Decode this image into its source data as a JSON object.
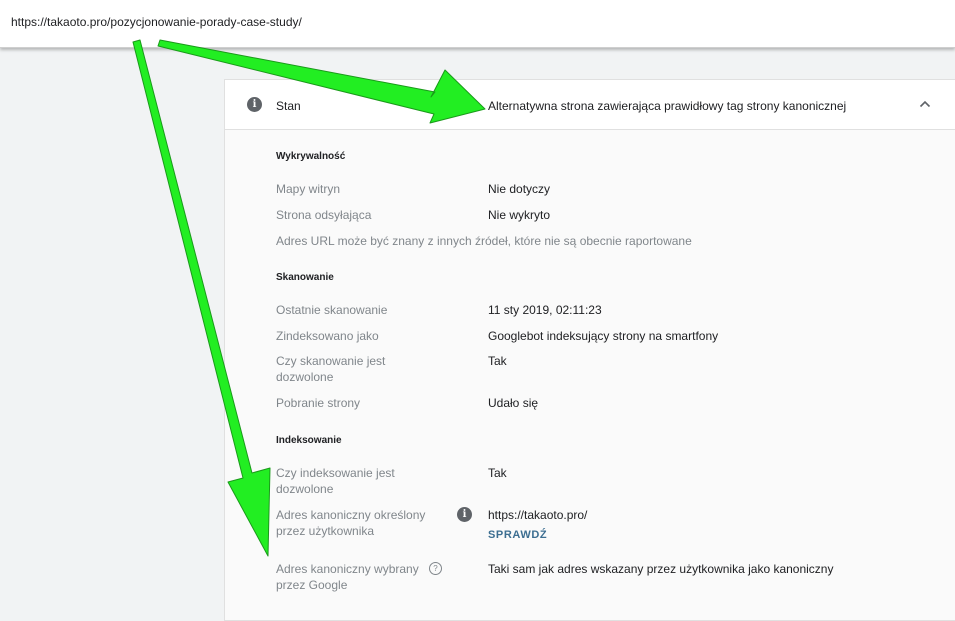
{
  "url_bar": {
    "url": "https://takaoto.pro/pozycjonowanie-porady-case-study/"
  },
  "header": {
    "label": "Stan",
    "status": "Alternatywna strona zawierająca prawidłowy tag strony kanonicznej",
    "info_icon_glyph": "i",
    "collapse_icon_glyph": "chevron-up"
  },
  "discoverability": {
    "title": "Wykrywalność",
    "rows": [
      {
        "label": "Mapy witryn",
        "value": "Nie dotyczy"
      },
      {
        "label": "Strona odsyłająca",
        "value": "Nie wykryto"
      }
    ],
    "note": "Adres URL może być znany z innych źródeł, które nie są obecnie raportowane"
  },
  "crawl": {
    "title": "Skanowanie",
    "rows": [
      {
        "label": "Ostatnie skanowanie",
        "value": "11 sty 2019, 02:11:23"
      },
      {
        "label": "Zindeksowano jako",
        "value": "Googlebot indeksujący strony na smartfony"
      },
      {
        "label_lines": [
          "Czy skanowanie jest",
          "dozwolone"
        ],
        "value": "Tak"
      },
      {
        "label": "Pobranie strony",
        "value": "Udało się"
      }
    ]
  },
  "indexing": {
    "title": "Indeksowanie",
    "rows": [
      {
        "label_lines": [
          "Czy indeksowanie jest",
          "dozwolone"
        ],
        "value": "Tak"
      },
      {
        "label_lines": [
          "Adres kanoniczny określony",
          "przez użytkownika"
        ],
        "value": "https://takaoto.pro/",
        "action": "SPRAWDŹ"
      },
      {
        "label_lines": [
          "Adres kanoniczny wybrany",
          "przez Google"
        ],
        "value": "Taki sam jak adres wskazany przez użytkownika jako kanoniczny",
        "help_icon_glyph": "?"
      }
    ]
  },
  "colors": {
    "arrow": "#22ee22",
    "arrow_outline": "#1a9a1a",
    "action_link": "#3c6e91",
    "label": "#80868b",
    "value": "#202124"
  }
}
